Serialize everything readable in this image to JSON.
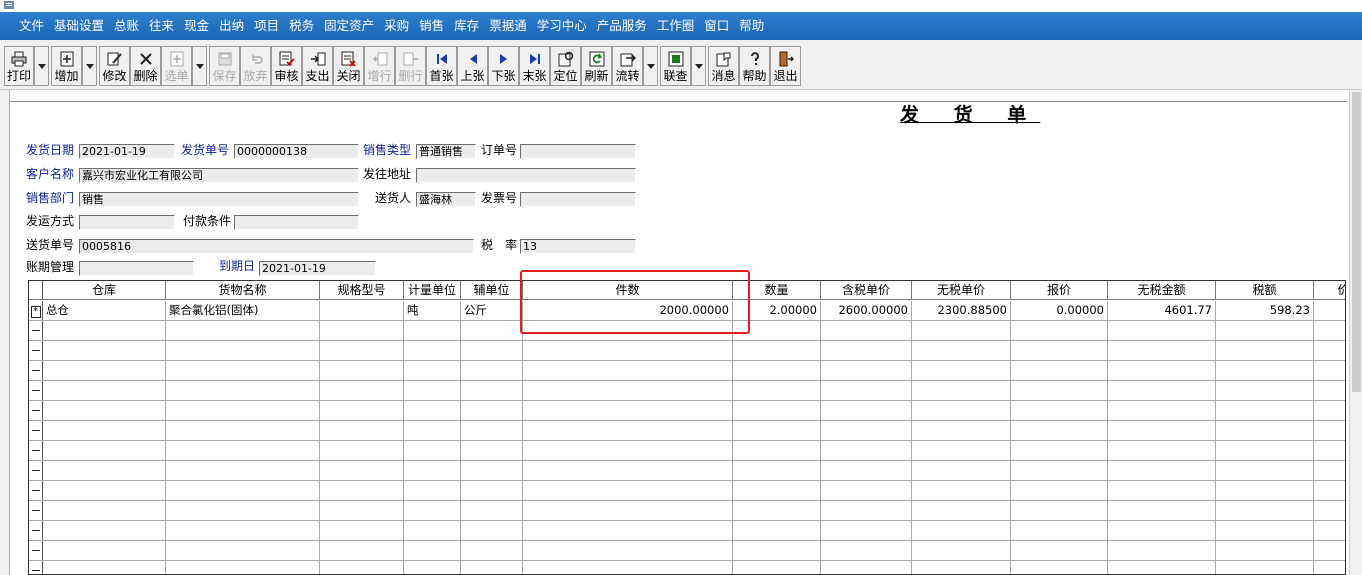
{
  "menu": [
    "文件",
    "基础设置",
    "总账",
    "往来",
    "现金",
    "出纳",
    "项目",
    "税务",
    "固定资产",
    "采购",
    "销售",
    "库存",
    "票据通",
    "学习中心",
    "产品服务",
    "工作圈",
    "窗口",
    "帮助"
  ],
  "toolbar": {
    "print": "打印",
    "add": "增加",
    "edit": "修改",
    "delete": "删除",
    "select": "选单",
    "save": "保存",
    "discard": "放弃",
    "review": "审核",
    "payment": "支出",
    "close": "关闭",
    "add_row": "增行",
    "delete_row": "删行",
    "first": "首张",
    "prev": "上张",
    "next": "下张",
    "last": "末张",
    "locate": "定位",
    "refresh": "刷新",
    "flow": "流转",
    "link": "联查",
    "message": "消息",
    "help": "帮助",
    "exit": "退出"
  },
  "document": {
    "title": "发 货 单",
    "fields": {
      "ship_date": {
        "label": "发货日期",
        "value": "2021-01-19"
      },
      "ship_no": {
        "label": "发货单号",
        "value": "0000000138"
      },
      "sale_type": {
        "label": "销售类型",
        "value": "普通销售"
      },
      "order_no": {
        "label": "订单号",
        "value": ""
      },
      "customer": {
        "label": "客户名称",
        "value": "嘉兴市宏业化工有限公司"
      },
      "ship_address": {
        "label": "发往地址",
        "value": ""
      },
      "sales_dept": {
        "label": "销售部门",
        "value": "销售"
      },
      "deliverer": {
        "label": "送货人",
        "value": "盛海林"
      },
      "invoice_no": {
        "label": "发票号",
        "value": ""
      },
      "ship_method": {
        "label": "发运方式",
        "value": ""
      },
      "payment_terms": {
        "label": "付款条件",
        "value": ""
      },
      "delivery_no": {
        "label": "送货单号",
        "value": "0005816"
      },
      "tax_rate": {
        "label": "税　率",
        "value": "13"
      },
      "account_mgmt": {
        "label": "账期管理",
        "value": ""
      },
      "due_date": {
        "label": "到期日",
        "value": "2021-01-19"
      }
    }
  },
  "grid": {
    "columns": [
      "仓库",
      "货物名称",
      "规格型号",
      "计量单位",
      "辅单位",
      "件数",
      "数量",
      "含税单价",
      "无税单价",
      "报价",
      "无税金额",
      "税额",
      "价"
    ],
    "rows": [
      {
        "warehouse": "总仓",
        "goods": "聚合氯化铝(固体)",
        "spec": "",
        "unit": "吨",
        "aux_unit": "公斤",
        "pieces": "2000.00000",
        "qty": "2.00000",
        "price_tax": "2600.00000",
        "price_notax": "2300.88500",
        "quote": "0.00000",
        "amount_notax": "4601.77",
        "tax": "598.23"
      }
    ],
    "empty_rows": 13
  }
}
